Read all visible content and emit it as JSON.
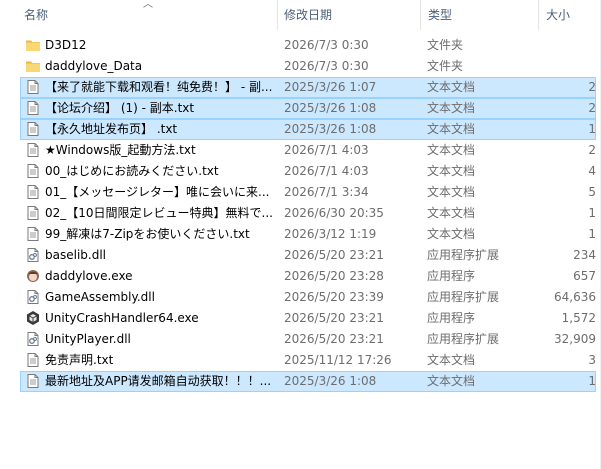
{
  "columns": {
    "name": "名称",
    "date": "修改日期",
    "type": "类型",
    "size": "大小"
  },
  "files": [
    {
      "name": "D3D12",
      "date": "2026/7/3 0:30",
      "type": "文件夹",
      "size": "",
      "icon": "folder-icon",
      "selected": false
    },
    {
      "name": "daddylove_Data",
      "date": "2026/7/3 0:30",
      "type": "文件夹",
      "size": "",
      "icon": "folder-icon",
      "selected": false
    },
    {
      "name": "【来了就能下载和观看！纯免费！】 - 副...",
      "date": "2025/3/26 1:07",
      "type": "文本文档",
      "size": "2",
      "icon": "text-file-icon",
      "selected": true
    },
    {
      "name": "【论坛介绍】 (1) - 副本.txt",
      "date": "2025/3/26 1:08",
      "type": "文本文档",
      "size": "2",
      "icon": "text-file-icon",
      "selected": true
    },
    {
      "name": "【永久地址发布页】 .txt",
      "date": "2025/3/26 1:08",
      "type": "文本文档",
      "size": "1",
      "icon": "text-file-icon",
      "selected": true
    },
    {
      "name": "★Windows版_起動方法.txt",
      "date": "2026/7/1 4:03",
      "type": "文本文档",
      "size": "2",
      "icon": "text-file-icon",
      "selected": false
    },
    {
      "name": "00_はじめにお読みください.txt",
      "date": "2026/7/1 4:03",
      "type": "文本文档",
      "size": "4",
      "icon": "text-file-icon",
      "selected": false
    },
    {
      "name": "01_【メッセージレター】唯に会いに来...",
      "date": "2026/7/1 3:34",
      "type": "文本文档",
      "size": "5",
      "icon": "text-file-icon",
      "selected": false
    },
    {
      "name": "02_【10日間限定レビュー特典】無料で...",
      "date": "2026/6/30 20:35",
      "type": "文本文档",
      "size": "1",
      "icon": "text-file-icon",
      "selected": false
    },
    {
      "name": "99_解凍は7-Zipをお使いください.txt",
      "date": "2026/3/12 1:19",
      "type": "文本文档",
      "size": "1",
      "icon": "text-file-icon",
      "selected": false
    },
    {
      "name": "baselib.dll",
      "date": "2026/5/20 23:21",
      "type": "应用程序扩展",
      "size": "234",
      "icon": "dll-file-icon",
      "selected": false
    },
    {
      "name": "daddylove.exe",
      "date": "2026/5/20 23:28",
      "type": "应用程序",
      "size": "657",
      "icon": "game-exe-icon",
      "selected": false
    },
    {
      "name": "GameAssembly.dll",
      "date": "2026/5/20 23:39",
      "type": "应用程序扩展",
      "size": "64,636",
      "icon": "dll-file-icon",
      "selected": false
    },
    {
      "name": "UnityCrashHandler64.exe",
      "date": "2026/5/20 23:21",
      "type": "应用程序",
      "size": "1,572",
      "icon": "unity-exe-icon",
      "selected": false
    },
    {
      "name": "UnityPlayer.dll",
      "date": "2026/5/20 23:21",
      "type": "应用程序扩展",
      "size": "32,909",
      "icon": "dll-file-icon",
      "selected": false
    },
    {
      "name": "免责声明.txt",
      "date": "2025/11/12 17:26",
      "type": "文本文档",
      "size": "3",
      "icon": "text-file-icon",
      "selected": false
    },
    {
      "name": "最新地址及APP请发邮箱自动获取！！！...",
      "date": "2025/3/26 1:08",
      "type": "文本文档",
      "size": "1",
      "icon": "text-file-icon",
      "selected": true
    }
  ],
  "colors": {
    "selection_bg": "#cce8ff",
    "selection_border": "#99d1ff",
    "header_text": "#4c607a",
    "folder": "#f8d775"
  }
}
